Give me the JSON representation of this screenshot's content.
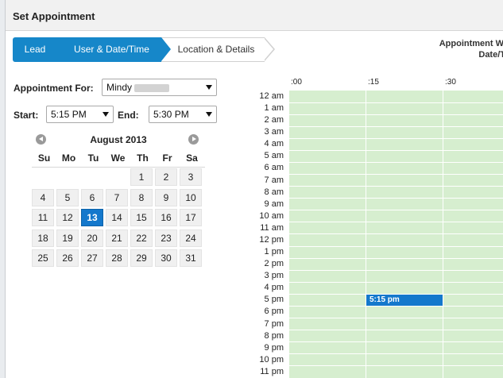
{
  "dialog": {
    "title": "Set Appointment"
  },
  "wizard": {
    "steps": [
      {
        "label": "Lead",
        "state": "done"
      },
      {
        "label": "User & Date/Time",
        "state": "active"
      },
      {
        "label": "Location & Details",
        "state": "upcoming"
      }
    ]
  },
  "appointment_window": {
    "line1": "Appointment W",
    "line2": "Date/T"
  },
  "form": {
    "appointment_for_label": "Appointment For:",
    "appointment_for_value": "Mindy",
    "start_label": "Start:",
    "start_value": "5:15 PM",
    "end_label": "End:",
    "end_value": "5:30 PM"
  },
  "calendar": {
    "month_label": "August 2013",
    "weekdays": [
      "Su",
      "Mo",
      "Tu",
      "We",
      "Th",
      "Fr",
      "Sa"
    ],
    "weeks": [
      [
        "",
        "",
        "",
        "",
        "1",
        "2",
        "3"
      ],
      [
        "4",
        "5",
        "6",
        "7",
        "8",
        "9",
        "10"
      ],
      [
        "11",
        "12",
        "13",
        "14",
        "15",
        "16",
        "17"
      ],
      [
        "18",
        "19",
        "20",
        "21",
        "22",
        "23",
        "24"
      ],
      [
        "25",
        "26",
        "27",
        "28",
        "29",
        "30",
        "31"
      ]
    ],
    "selected_day": "13"
  },
  "schedule": {
    "minute_columns": [
      ":00",
      ":15",
      ":30"
    ],
    "hours": [
      "12 am",
      "1 am",
      "2 am",
      "3 am",
      "4 am",
      "5 am",
      "6 am",
      "7 am",
      "8 am",
      "9 am",
      "10 am",
      "11 am",
      "12 pm",
      "1 pm",
      "2 pm",
      "3 pm",
      "4 pm",
      "5 pm",
      "6 pm",
      "7 pm",
      "8 pm",
      "9 pm",
      "10 pm",
      "11 pm"
    ],
    "appointment": {
      "label": "5:15 pm",
      "hour": "5 pm",
      "minute": ":15"
    }
  },
  "colors": {
    "accent": "#1687c9",
    "selected": "#1478cc",
    "slot_available": "#d6eecf"
  }
}
